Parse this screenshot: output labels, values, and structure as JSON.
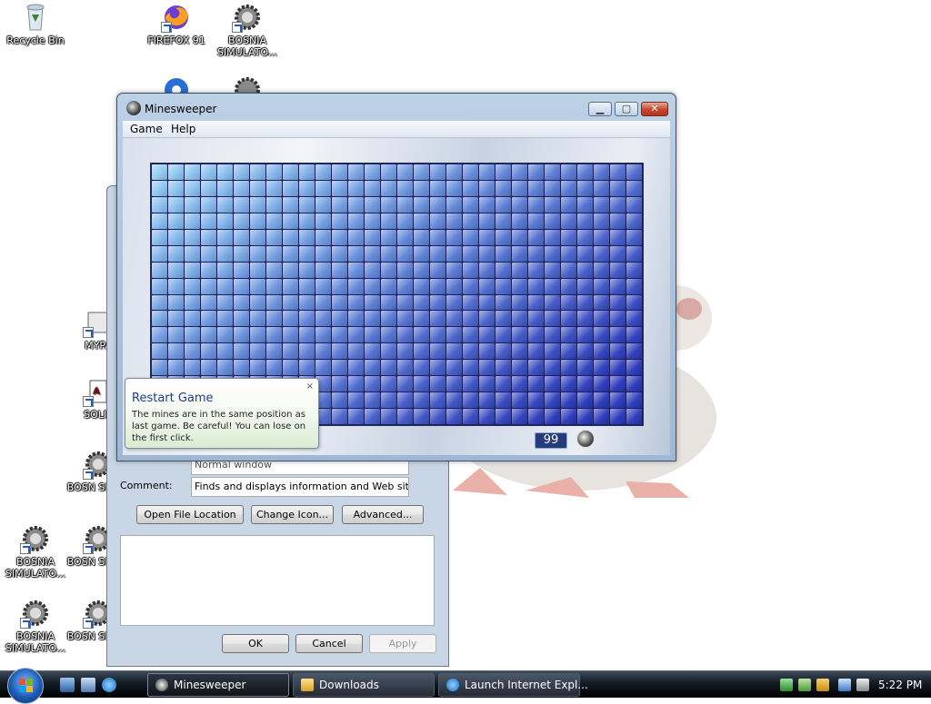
{
  "desktop": {
    "icons": [
      {
        "label": "Recycle Bin"
      },
      {
        "label": "FIREFOX 91"
      },
      {
        "label": "BOSNIA SIMULATO..."
      },
      {
        "label": "MYPA"
      },
      {
        "label": "SOLIT"
      },
      {
        "label": "BOSN SIMUL"
      },
      {
        "label": "BOSNIA SIMULATO..."
      },
      {
        "label": "BOSN SIMUL"
      },
      {
        "label": "BOSNIA SIMULATO..."
      },
      {
        "label": "BOSN SIMUL"
      }
    ]
  },
  "properties_window": {
    "run_value": "Normal window",
    "comment_label": "Comment:",
    "comment_value": "Finds and displays information and Web sites on th",
    "buttons": {
      "open_file_location": "Open File Location",
      "change_icon": "Change Icon...",
      "advanced": "Advanced...",
      "ok": "OK",
      "cancel": "Cancel",
      "apply": "Apply"
    }
  },
  "minesweeper": {
    "title": "Minesweeper",
    "menu": {
      "game": "Game",
      "help": "Help"
    },
    "board": {
      "columns": 30,
      "rows": 16
    },
    "mines_remaining": "99",
    "colors": {
      "tile_top_left": "#8ec9f2",
      "tile_bottom_right": "#2634b8"
    }
  },
  "balloon": {
    "title": "Restart Game",
    "body": "The mines are in the same position as last game. Be careful! You can lose on the first click.",
    "close": "×"
  },
  "taskbar": {
    "buttons": [
      {
        "label": "Minesweeper",
        "active": true
      },
      {
        "label": "Downloads",
        "active": false
      },
      {
        "label": "Launch Internet Expl...",
        "active": false
      }
    ],
    "clock": "5:22 PM"
  }
}
